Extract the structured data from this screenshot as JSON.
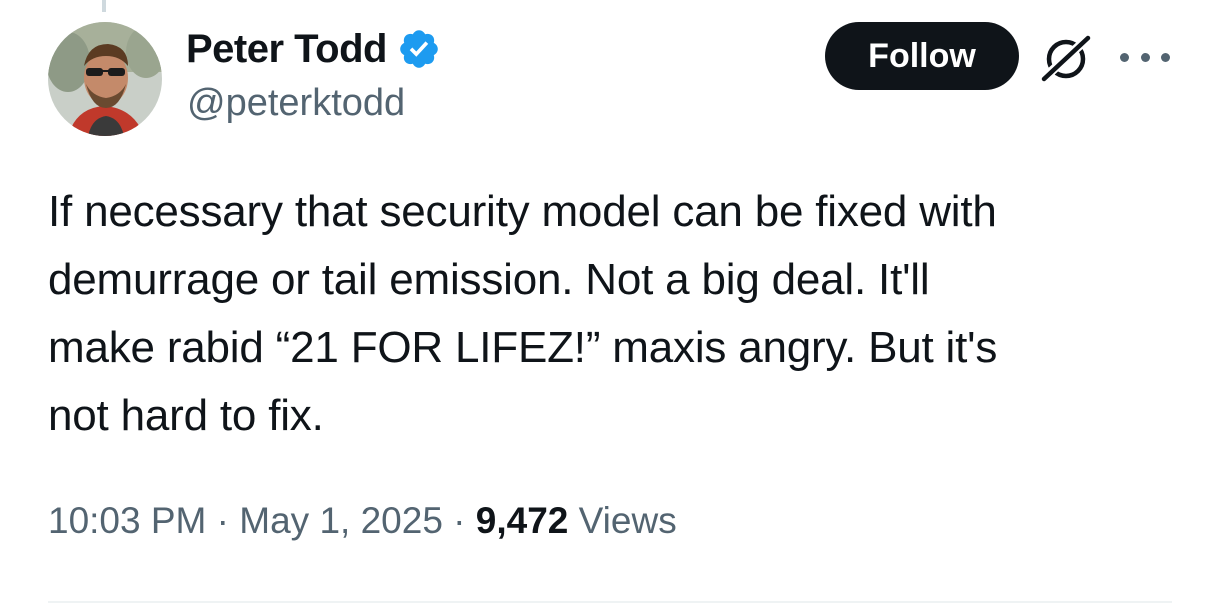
{
  "author": {
    "display_name": "Peter Todd",
    "handle": "@peterktodd",
    "verified": true,
    "verified_color": "#1d9bf0"
  },
  "actions": {
    "follow_label": "Follow",
    "grok_icon": "grok-icon",
    "more_icon": "more-options-icon"
  },
  "tweet": {
    "text_lines": [
      "If necessary that security model can be fixed with",
      "demurrage or tail emission. Not a big deal. It'll",
      "make rabid “21 FOR LIFEZ!” maxis angry. But it's",
      "not hard to fix."
    ]
  },
  "meta": {
    "time": "10:03 PM",
    "separator": " · ",
    "date": "May 1, 2025",
    "views_count": "9,472",
    "views_label": " Views"
  },
  "colors": {
    "text_primary": "#0f1419",
    "text_secondary": "#536471",
    "follow_bg": "#0f1419",
    "divider": "#eff3f4"
  }
}
